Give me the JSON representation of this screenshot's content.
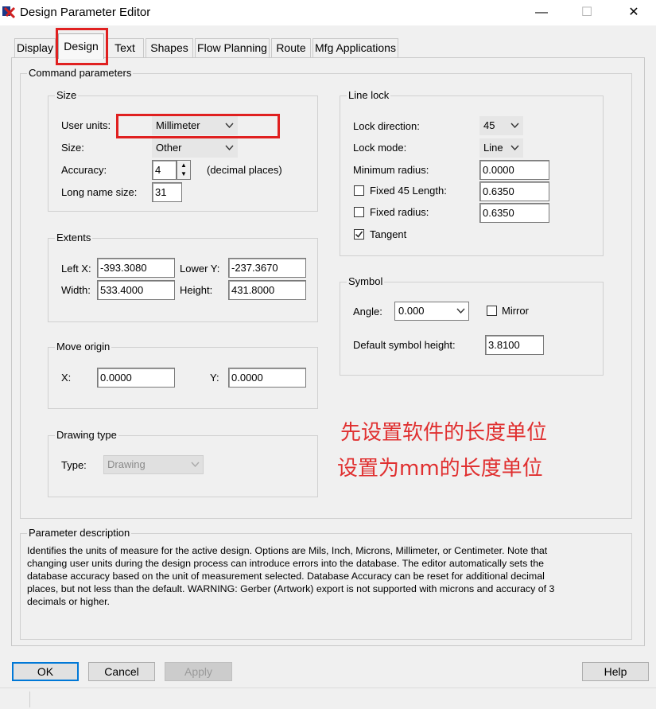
{
  "window": {
    "title": "Design Parameter Editor",
    "minimize": "—",
    "maximize": "☐",
    "close": "✕"
  },
  "tabs": [
    "Display",
    "Design",
    "Text",
    "Shapes",
    "Flow Planning",
    "Route",
    "Mfg Applications"
  ],
  "active_tab": "Design",
  "command_parameters": {
    "label": "Command parameters",
    "size": {
      "label": "Size",
      "user_units_label": "User units:",
      "user_units_value": "Millimeter",
      "size_label": "Size:",
      "size_value": "Other",
      "accuracy_label": "Accuracy:",
      "accuracy_value": "4",
      "accuracy_suffix": "(decimal places)",
      "long_name_label": "Long name size:",
      "long_name_value": "31"
    },
    "extents": {
      "label": "Extents",
      "left_x_label": "Left X:",
      "left_x_value": "-393.3080",
      "lower_y_label": "Lower Y:",
      "lower_y_value": "-237.3670",
      "width_label": "Width:",
      "width_value": "533.4000",
      "height_label": "Height:",
      "height_value": "431.8000"
    },
    "move_origin": {
      "label": "Move origin",
      "x_label": "X:",
      "x_value": "0.0000",
      "y_label": "Y:",
      "y_value": "0.0000"
    },
    "drawing_type": {
      "label": "Drawing type",
      "type_label": "Type:",
      "type_value": "Drawing"
    },
    "line_lock": {
      "label": "Line lock",
      "lock_direction_label": "Lock direction:",
      "lock_direction_value": "45",
      "lock_mode_label": "Lock mode:",
      "lock_mode_value": "Line",
      "min_radius_label": "Minimum radius:",
      "min_radius_value": "0.0000",
      "fixed45_label": "Fixed 45 Length:",
      "fixed45_checked": false,
      "fixed45_value": "0.6350",
      "fixed_radius_label": "Fixed radius:",
      "fixed_radius_checked": false,
      "fixed_radius_value": "0.6350",
      "tangent_label": "Tangent",
      "tangent_checked": true
    },
    "symbol": {
      "label": "Symbol",
      "angle_label": "Angle:",
      "angle_value": "0.000",
      "mirror_label": "Mirror",
      "mirror_checked": false,
      "default_height_label": "Default symbol height:",
      "default_height_value": "3.8100"
    }
  },
  "annotation": {
    "line1": "先设置软件的长度单位",
    "line2": "设置为mm的长度单位",
    "color": "#e03030"
  },
  "parameter_description": {
    "label": "Parameter description",
    "lines": [
      "Identifies the units of measure for the active design. Options are Mils, Inch, Microns, Millimeter, or Centimeter. Note that",
      "changing user units during the design process can introduce errors into the database.  The editor automatically sets the",
      "database accuracy based on the unit of measurement selected. Database Accuracy can be reset for additional decimal",
      "places, but not less than the default. WARNING: Gerber (Artwork) export is not supported with microns and accuracy of 3",
      "decimals or higher."
    ]
  },
  "buttons": {
    "ok": "OK",
    "cancel": "Cancel",
    "apply": "Apply",
    "help": "Help"
  },
  "icons": {
    "app": "design-app-icon",
    "combo_arrow": "chevron-down-icon",
    "check": "checkmark-icon"
  }
}
